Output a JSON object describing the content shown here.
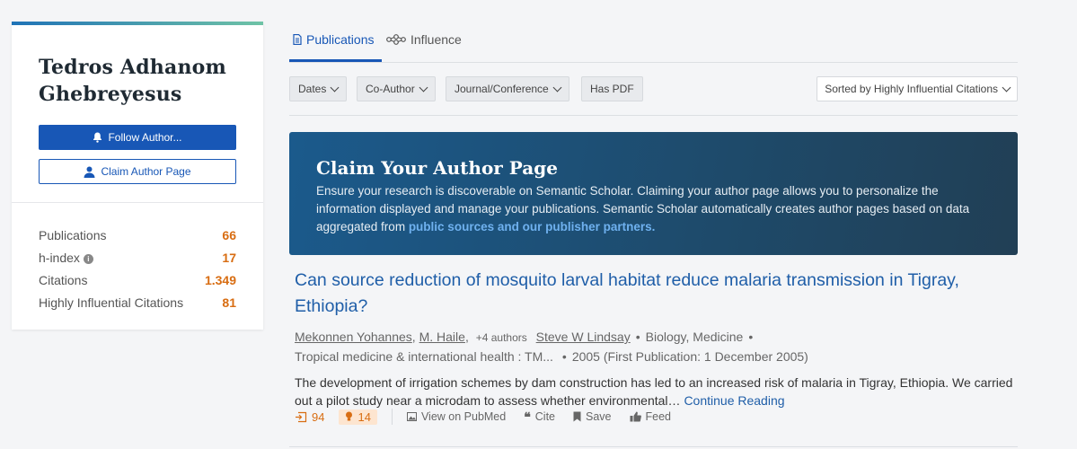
{
  "author": {
    "name": "Tedros Adhanom Ghebreyesus",
    "follow_label": "Follow Author...",
    "claim_label": "Claim Author Page",
    "stats": [
      {
        "label": "Publications",
        "value": "66"
      },
      {
        "label": "h-index",
        "value": "17"
      },
      {
        "label": "Citations",
        "value": "1.349"
      },
      {
        "label": "Highly Influential Citations",
        "value": "81"
      }
    ]
  },
  "tabs": {
    "publications": "Publications",
    "influence": "Influence"
  },
  "filters": {
    "dates": "Dates",
    "coauthor": "Co-Author",
    "journal": "Journal/Conference",
    "haspdf": "Has PDF",
    "sort": "Sorted by Highly Influential Citations"
  },
  "banner": {
    "title": "Claim Your Author Page",
    "text": "Ensure your research is discoverable on Semantic Scholar. Claiming your author page allows you to personalize the information displayed and manage your publications. Semantic Scholar automatically creates author pages based on data aggregated from ",
    "link": "public sources and our publisher partners."
  },
  "paper": {
    "title": "Can source reduction of mosquito larval habitat reduce malaria transmission in Tigray, Ethiopia?",
    "authors": [
      "Mekonnen Yohannes",
      "M. Haile"
    ],
    "more_authors": "+4 authors",
    "last_author": "Steve W Lindsay",
    "fields": "Biology, Medicine",
    "venue": "Tropical medicine & international health : TM...",
    "year": "2005 (First Publication: 1 December 2005)",
    "abstract": "The development of irrigation schemes by dam construction has led to an increased risk of malaria in Tigray, Ethiopia. We carried out a pilot study near a microdam to assess whether environmental…",
    "continue": "Continue Reading",
    "citations": "94",
    "influential": "14",
    "actions": {
      "pubmed": "View on PubMed",
      "cite": "Cite",
      "save": "Save",
      "feed": "Feed"
    }
  },
  "colors": {
    "accent": "#1857b6",
    "stat": "#d86d12",
    "link": "#1f5ea8"
  }
}
